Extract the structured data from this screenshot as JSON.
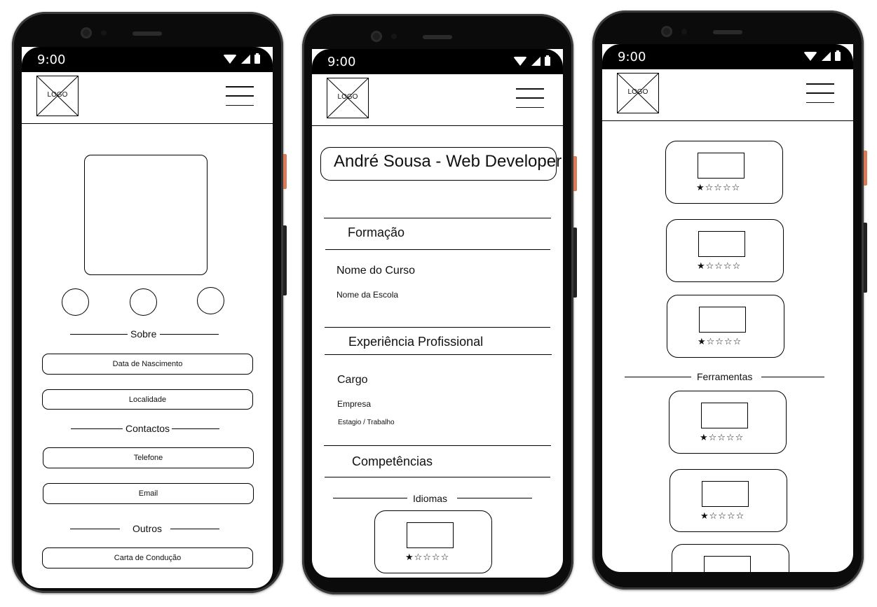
{
  "status": {
    "time": "9:00"
  },
  "header": {
    "logo": "LOGO"
  },
  "rating": {
    "stars": "★☆☆☆☆"
  },
  "profile": {
    "sections": {
      "about": "Sobre",
      "contacts": "Contactos",
      "others": "Outros"
    },
    "fields": {
      "birth_date": "Data de Nascimento",
      "location": "Localidade",
      "phone": "Telefone",
      "email": "Email",
      "license": "Carta de Condução"
    }
  },
  "cv": {
    "title": "André Sousa - Web Developer",
    "education": {
      "heading": "Formação",
      "course": "Nome do Curso",
      "school": "Nome da Escola"
    },
    "experience": {
      "heading": "Experiência Profissional",
      "role": "Cargo",
      "company": "Empresa",
      "type": "Estagio / Trabalho"
    },
    "skills": {
      "heading": "Competências",
      "languages": "Idiomas"
    }
  },
  "tools": {
    "heading": "Ferramentas"
  }
}
